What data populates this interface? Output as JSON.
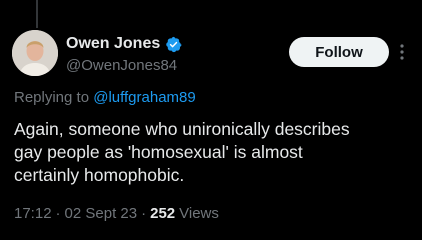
{
  "tweet": {
    "author": {
      "name": "Owen Jones",
      "handle": "@OwenJones84",
      "verified": true
    },
    "follow_label": "Follow",
    "more_icon": "more-vertical-icon",
    "replying_prefix": "Replying to",
    "replying_to": "@luffgraham89",
    "text": "Again, someone who unironically describes\ngay people as 'homosexual' is almost\ncertainly homophobic.",
    "time": "17:12",
    "date": "02 Sept 23",
    "separator": "·",
    "views_count": "252",
    "views_label": "Views"
  },
  "colors": {
    "background": "#000000",
    "text_primary": "#e7e9ea",
    "text_secondary": "#71767b",
    "accent": "#1d9bf0",
    "button_bg": "#eff3f4"
  }
}
